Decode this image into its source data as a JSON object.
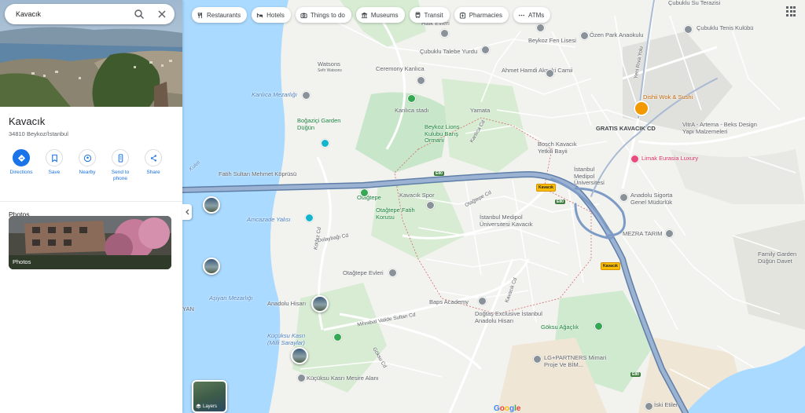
{
  "search": {
    "value": "Kavacık"
  },
  "place": {
    "name": "Kavacık",
    "address": "34810 Beykoz/İstanbul"
  },
  "actions": [
    {
      "label": "Directions",
      "icon": "directions-icon"
    },
    {
      "label": "Save",
      "icon": "bookmark-icon"
    },
    {
      "label": "Nearby",
      "icon": "nearby-icon"
    },
    {
      "label": "Send to phone",
      "icon": "phone-icon"
    },
    {
      "label": "Share",
      "icon": "share-icon"
    }
  ],
  "photos": {
    "heading": "Photos",
    "card_caption": "Photos"
  },
  "chips": [
    {
      "label": "Restaurants",
      "icon": "fork-knife-icon"
    },
    {
      "label": "Hotels",
      "icon": "bed-icon"
    },
    {
      "label": "Things to do",
      "icon": "camera-icon"
    },
    {
      "label": "Museums",
      "icon": "museum-icon"
    },
    {
      "label": "Transit",
      "icon": "train-icon"
    },
    {
      "label": "Pharmacies",
      "icon": "pharmacy-icon"
    },
    {
      "label": "ATMs",
      "icon": "atm-icon"
    }
  ],
  "layers": {
    "label": "Layers"
  },
  "colors": {
    "accent": "#1a73e8",
    "water": "#aadaff",
    "park": "#c8e6c9",
    "highway": "#7d9bc4"
  },
  "map_labels": {
    "cubuklu_su": "Çubuklu Su Terazisi",
    "cubuklu_tenis": "Çubuklu Tenis Kulübü",
    "ozen_park": "Özen Park Anaokulu",
    "halk_evleri": "Halk Evleri",
    "beykoz_fen": "Beykoz Fen Lisesi",
    "talebe_yurdu": "Çubuklu Talebe Yurdu",
    "watsons": "Watsons",
    "watsons_sub": "Sefir Watsons",
    "ceremony": "Ceremony Kanlıca",
    "ahmet_hamdi": "Ahmet Hamdi Akseki Camii",
    "kanlica_mesire": "Kanlıca Mezarlığı",
    "kanlica_stad": "Kanlıca stadı",
    "yamata": "Yamata",
    "dishii": "Dishii Wok & Sushi",
    "gratis": "GRATIS KAVACIK CD",
    "vitra": "VitrA - Artema - Beks Design Yapı Malzemeleri",
    "beykoz_lions": "Beykoz Lions Kulubu Barış Ormanı",
    "bogazici_garden": "Boğaziçi Garden Düğün",
    "bosch": "Bosch Kavacık Yetkili Bayii",
    "limak": "Limak Eurasia Luxury",
    "istanbul_medipol": "İstanbul Medipol Üniversitesi",
    "fatih_sultan": "Fatih Sultan Mehmet Köprüsü",
    "anadolu_sigorta": "Anadolu Sigorta Genel Müdürlük",
    "otagtepe": "Otağtepe",
    "kavacik_spor": "Kavacık Spor",
    "otagtepe_fatih": "Otağtepe Fatih Korusu",
    "medipol_kavacik": "İstanbul Medipol Üniversitesi Kavacık",
    "mezra": "MEZRA TARIM",
    "family_garden": "Family Garden Düğün Davet",
    "amcazade": "Amcazade Yalısı",
    "otagtepe_evleri": "Otağtepe Evleri",
    "asiyan": "Aşiyan Mezarlığı",
    "anadolu_hisari": "Anadolu Hisarı",
    "baps": "Baps Academy",
    "dogtas": "Doğtaş Exclusive İstanbul Anadolu Hisarı",
    "goksu": "Göksu Ağaçlık",
    "kucuksu_kasri": "Küçüksu Kasrı (Milli Saraylar)",
    "lg_partners": "LG+PARTNERS Mimari Proje Ve BİM...",
    "kucuksu_mesire": "Küçüksu Kasrı Mesire Alanı",
    "iski": "İski Etiler",
    "otagtepe_cd": "Otağtepe Cd",
    "korfez_cd": "Körfez Cd",
    "dolaybagi_cd": "Dolaybağı Cd",
    "kavacik_cd": "Kavacık Cd",
    "mihrabat": "Mihrabat Valide Sultan Cd",
    "goksu_cd": "Göksu Cd",
    "kuleli": "Kuleli",
    "yan": "YAN",
    "kanlica_cd": "Kanlıca Cd",
    "yeniriva": "Yeni Rıva Yolu"
  },
  "shields": {
    "e80": "E80",
    "kavacik_exit": "Kavacık"
  }
}
